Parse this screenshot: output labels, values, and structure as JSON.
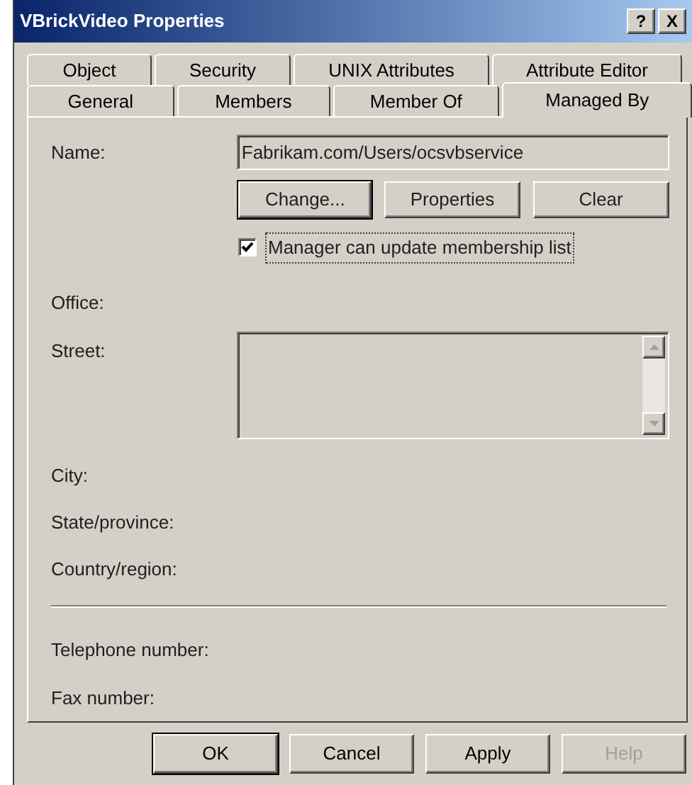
{
  "window": {
    "title": "VBrickVideo Properties",
    "controls": [
      "?",
      "X"
    ]
  },
  "tab_rows": [
    [
      {
        "label": "Object",
        "selected": false
      },
      {
        "label": "Security",
        "selected": false
      },
      {
        "label": "UNIX Attributes",
        "selected": false
      },
      {
        "label": "Attribute Editor",
        "selected": false
      }
    ],
    [
      {
        "label": "General",
        "selected": false
      },
      {
        "label": "Members",
        "selected": false
      },
      {
        "label": "Member Of",
        "selected": false
      },
      {
        "label": "Managed By",
        "selected": true
      }
    ]
  ],
  "name": {
    "label": "Name:",
    "value": "Fabrikam.com/Users/ocsvbservice"
  },
  "name_buttons": [
    {
      "label": "Change...",
      "default": true
    },
    {
      "label": "Properties",
      "default": false
    },
    {
      "label": "Clear",
      "default": false
    }
  ],
  "checkbox": {
    "label": "Manager can update membership list",
    "checked": true
  },
  "office": {
    "label": "Office:"
  },
  "street": {
    "label": "Street:"
  },
  "address_fields": [
    {
      "label": "City:"
    },
    {
      "label": "State/province:"
    },
    {
      "label": "Country/region:"
    }
  ],
  "phone_fields": [
    {
      "label": "Telephone number:"
    },
    {
      "label": "Fax number:"
    }
  ],
  "buttons": [
    {
      "label": "OK",
      "default": true,
      "disabled": false
    },
    {
      "label": "Cancel",
      "default": false,
      "disabled": false
    },
    {
      "label": "Apply",
      "default": false,
      "disabled": false
    },
    {
      "label": "Help",
      "default": false,
      "disabled": true
    }
  ]
}
